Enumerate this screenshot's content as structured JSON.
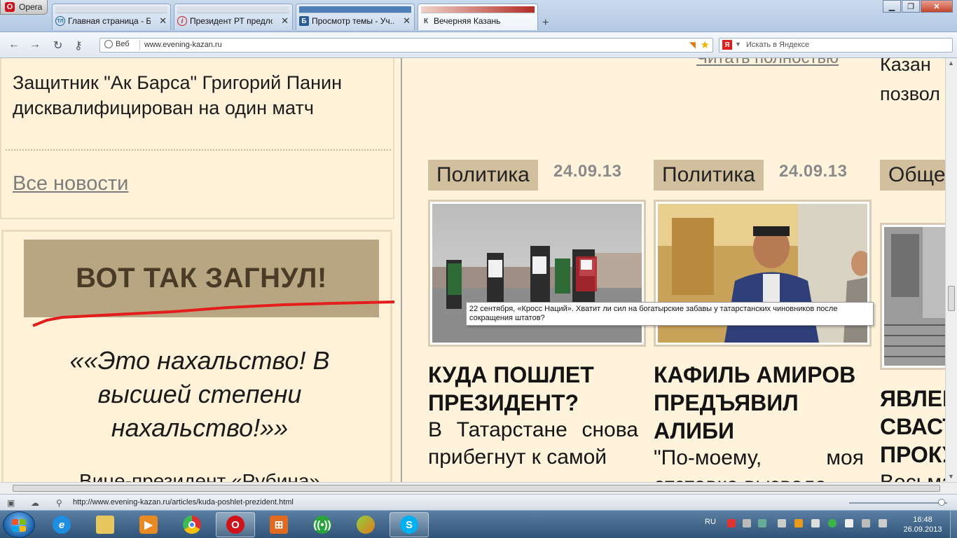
{
  "browser": {
    "menu_label": "Opera",
    "tabs": [
      {
        "label": "Главная страница - Б...",
        "favicon": "ТЛ"
      },
      {
        "label": "Президент РТ предло...",
        "favicon": "i"
      },
      {
        "label": "Просмотр темы - Уч...",
        "favicon": "Б"
      },
      {
        "label": "Вечерняя Казань",
        "favicon": "К"
      }
    ],
    "address": {
      "mode_label": "Веб",
      "url": "www.evening-kazan.ru"
    },
    "search": {
      "engine": "Я",
      "placeholder": "Искать в Яндексе"
    }
  },
  "page": {
    "left_news_title": "Защитник \"Ак Барса\" Григорий Панин дисквалифицирован на один матч",
    "all_news": "Все новости",
    "quote_heading": "ВОТ ТАК ЗАГНУЛ!",
    "quote_text": "««Это нахальство! В высшей степени нахальство!»»",
    "quote_author": "Вице-президент «Рубина»",
    "read_more": "Читать полностью",
    "right_clip_lines": [
      "Казан",
      "позвол"
    ],
    "articles": [
      {
        "category": "Политика",
        "date": "24.09.13",
        "headline": "КУДА ПОШЛЕТ ПРЕЗИДЕНТ?",
        "lead": "В Татарстане снова прибегнут к самой"
      },
      {
        "category": "Политика",
        "date": "24.09.13",
        "headline": "КАФИЛЬ АМИРОВ ПРЕДЪЯВИЛ АЛИБИ",
        "lead": "\"По-моему, моя отставка вызвала"
      },
      {
        "category": "Общество",
        "headline": "ЯВЛЕНИЕ СВАСТИКИ В ПРОКУРАТУРЕ",
        "lead": "Весьма"
      }
    ],
    "tooltip": "22 сентября, «Кросс Наций». Хватит ли сил на богатырские забавы  у татарстанских чиновников  после сокращения штатов?"
  },
  "statusbar": {
    "url": "http://www.evening-kazan.ru/articles/kuda-poshlet-prezident.html",
    "zoom_percent": 100
  },
  "taskbar": {
    "language": "RU",
    "time": "16:48",
    "date": "26.09.2013",
    "apps": [
      "ie",
      "explorer",
      "media-player",
      "chrome",
      "opera",
      "file-manager",
      "network-app",
      "green-app",
      "skype"
    ]
  },
  "colors": {
    "category_bg": "#d2bf9e",
    "page_bg": "#fff3dc",
    "quote_head_bg": "#b8a582",
    "accent_red": "#e31c1c"
  }
}
